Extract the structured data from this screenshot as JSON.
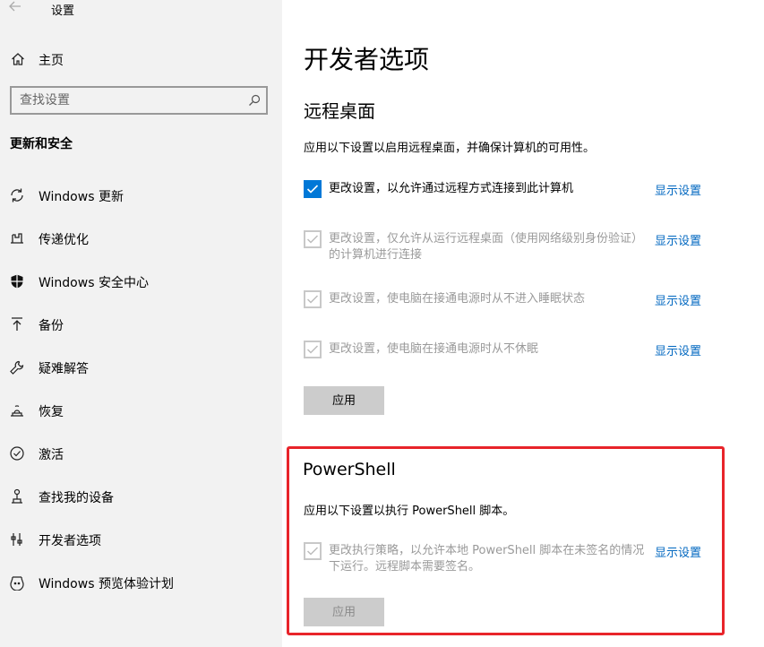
{
  "window": {
    "title": "设置"
  },
  "sidebar": {
    "home_label": "主页",
    "search_placeholder": "查找设置",
    "section_title": "更新和安全",
    "items": [
      {
        "label": "Windows 更新",
        "icon": "sync-icon"
      },
      {
        "label": "传递优化",
        "icon": "delivery-optimization-icon"
      },
      {
        "label": "Windows 安全中心",
        "icon": "shield-icon"
      },
      {
        "label": "备份",
        "icon": "backup-icon"
      },
      {
        "label": "疑难解答",
        "icon": "wrench-icon"
      },
      {
        "label": "恢复",
        "icon": "recovery-icon"
      },
      {
        "label": "激活",
        "icon": "check-circle-icon"
      },
      {
        "label": "查找我的设备",
        "icon": "find-device-icon"
      },
      {
        "label": "开发者选项",
        "icon": "developer-icon"
      },
      {
        "label": "Windows 预览体验计划",
        "icon": "insider-icon"
      }
    ]
  },
  "main": {
    "page_title": "开发者选项",
    "remote_desktop": {
      "heading": "远程桌面",
      "description": "应用以下设置以启用远程桌面，并确保计算机的可用性。",
      "options": [
        {
          "text": "更改设置，以允许通过远程方式连接到此计算机",
          "checked": true,
          "disabled": false,
          "link": "显示设置"
        },
        {
          "text": "更改设置，仅允许从运行远程桌面（使用网络级别身份验证）的计算机进行连接",
          "checked": true,
          "disabled": true,
          "link": "显示设置"
        },
        {
          "text": "更改设置，使电脑在接通电源时从不进入睡眠状态",
          "checked": true,
          "disabled": true,
          "link": "显示设置"
        },
        {
          "text": "更改设置，使电脑在接通电源时从不休眠",
          "checked": true,
          "disabled": true,
          "link": "显示设置"
        }
      ],
      "apply_label": "应用"
    },
    "powershell": {
      "heading": "PowerShell",
      "description": "应用以下设置以执行 PowerShell 脚本。",
      "options": [
        {
          "text": "更改执行策略，以允许本地 PowerShell 脚本在未签名的情况下运行。远程脚本需要签名。",
          "checked": true,
          "disabled": true,
          "link": "显示设置"
        }
      ],
      "apply_label": "应用"
    },
    "colors": {
      "accent": "#0078d7",
      "link": "#0067c0",
      "highlight": "#e8242a"
    }
  }
}
